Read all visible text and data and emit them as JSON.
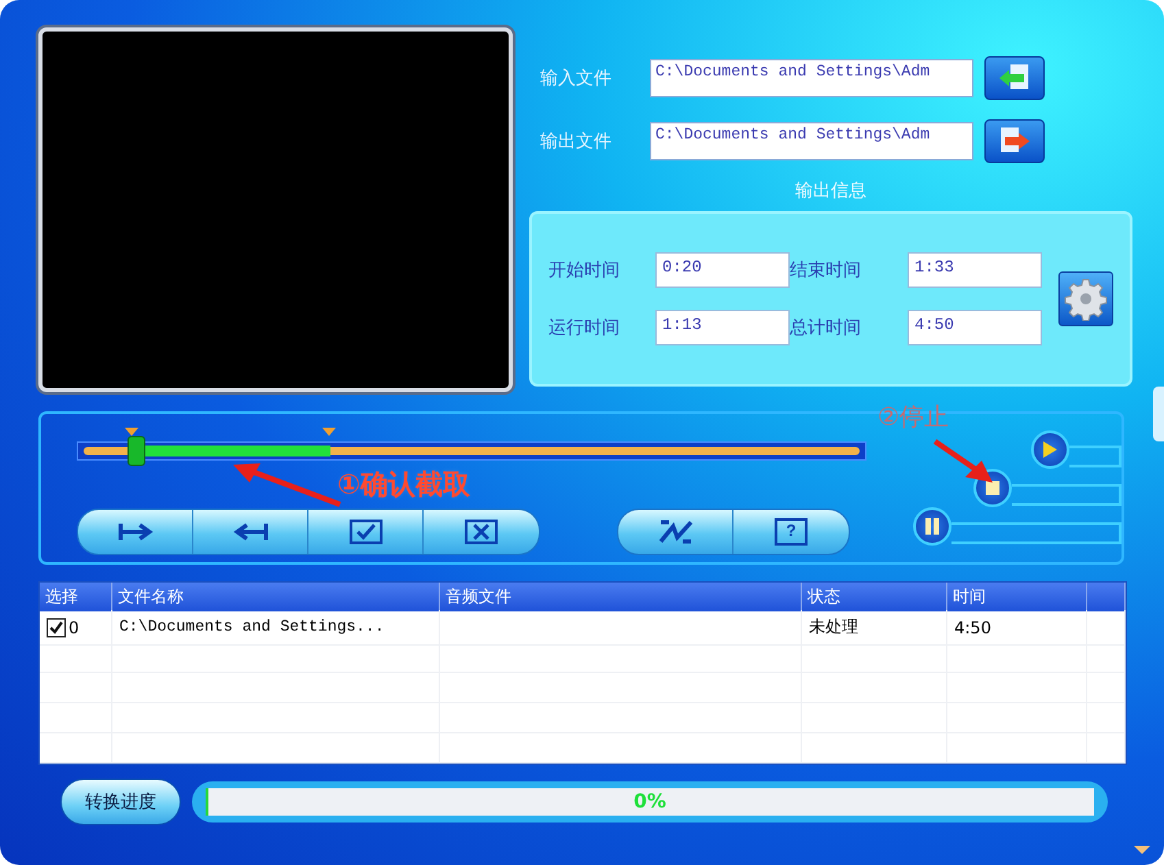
{
  "files": [
    {
      "kind": "input",
      "label": "输入文件",
      "value": "C:\\Documents and Settings\\Adm"
    },
    {
      "kind": "output",
      "label": "输出文件",
      "value": "C:\\Documents and Settings\\Adm"
    }
  ],
  "output_info": {
    "title": "输出信息",
    "fields": [
      {
        "label": "开始时间",
        "value": "0:20"
      },
      {
        "label": "结束时间",
        "value": "1:33"
      },
      {
        "label": "运行时间",
        "value": "1:13"
      },
      {
        "label": "总计时间",
        "value": "4:50"
      }
    ]
  },
  "timeline": {
    "playhead": {
      "level": 0.075
    },
    "range_start": {
      "level": 0.069
    },
    "range_end": {
      "level": 0.32
    }
  },
  "edit_buttons": [
    {
      "kind": "mark-in"
    },
    {
      "kind": "mark-out"
    },
    {
      "kind": "confirm"
    },
    {
      "kind": "delete"
    }
  ],
  "tool_buttons": [
    {
      "kind": "convert"
    },
    {
      "kind": "help",
      "label": "?"
    }
  ],
  "playback_buttons": [
    {
      "kind": "play"
    },
    {
      "kind": "stop"
    },
    {
      "kind": "pause"
    }
  ],
  "annotations": [
    {
      "kind": "confirm",
      "text": "①确认截取"
    },
    {
      "kind": "stop",
      "text": "②停止"
    }
  ],
  "table": {
    "columns": [
      "选择",
      "文件名称",
      "音频文件",
      "状态",
      "时间"
    ],
    "rows": [
      {
        "checked": true,
        "select": "0",
        "file_name": "C:\\Documents and Settings...",
        "status": "未处理",
        "time": "4:50"
      }
    ]
  },
  "progress": {
    "button": "转换进度",
    "level": 0,
    "reading": "0%"
  }
}
